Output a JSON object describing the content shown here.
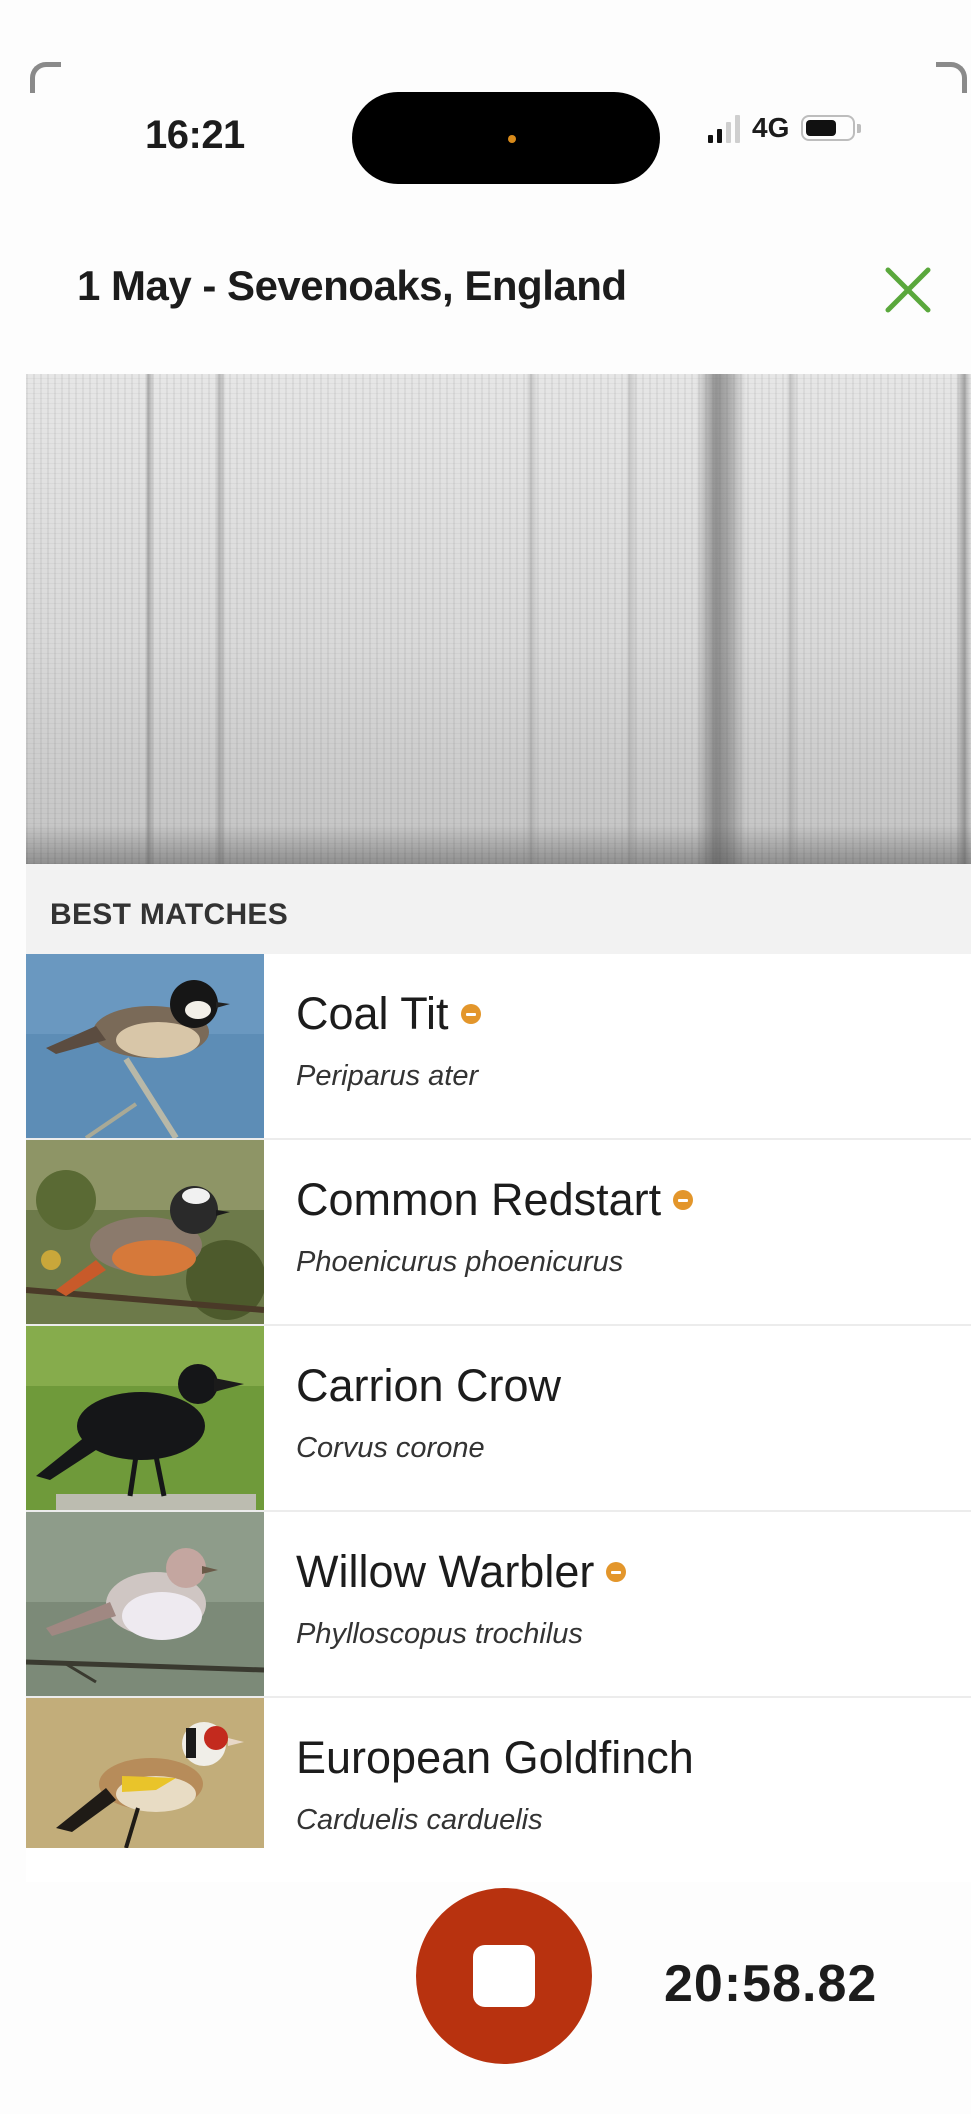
{
  "status_bar": {
    "time": "16:21",
    "network": "4G",
    "signal_bars": 2,
    "battery_level": 0.6
  },
  "header": {
    "title": "1 May - Sevenoaks, England"
  },
  "section": {
    "label": "BEST MATCHES"
  },
  "matches": [
    {
      "common": "Coal Tit",
      "scientific": "Periparus ater",
      "badge": true,
      "icon": "coal-tit-photo"
    },
    {
      "common": "Common Redstart",
      "scientific": "Phoenicurus phoenicurus",
      "badge": true,
      "icon": "common-redstart-photo"
    },
    {
      "common": "Carrion Crow",
      "scientific": "Corvus corone",
      "badge": false,
      "icon": "carrion-crow-photo"
    },
    {
      "common": "Willow Warbler",
      "scientific": "Phylloscopus trochilus",
      "badge": true,
      "icon": "willow-warbler-photo"
    },
    {
      "common": "European Goldfinch",
      "scientific": "Carduelis carduelis",
      "badge": false,
      "icon": "european-goldfinch-photo"
    }
  ],
  "recorder": {
    "elapsed": "20:58.82"
  },
  "colors": {
    "accent_green": "#5aa83c",
    "stop_red": "#b8320f",
    "badge_orange": "#e3962b"
  }
}
